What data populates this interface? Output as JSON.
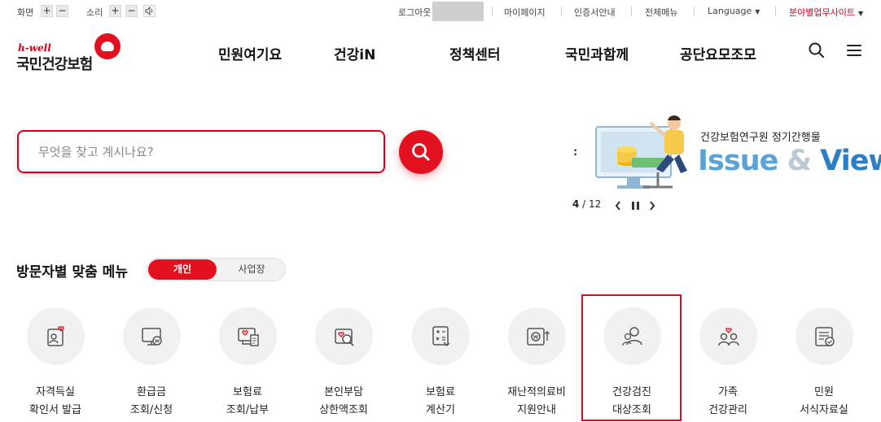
{
  "util": {
    "screen_label": "화면",
    "sound_label": "소리",
    "plus": "+",
    "minus": "−",
    "logout": "로그아웃",
    "mypage": "마이페이지",
    "cert": "인증서안내",
    "allmenu": "전체메뉴",
    "language": "Language",
    "field_site": "분야별업무사이트"
  },
  "logo": {
    "sub": "h-well",
    "name": "국민건강보험"
  },
  "gnb": [
    "민원여기요",
    "건강iN",
    "정책센터",
    "국민과함께",
    "공단요모조모"
  ],
  "search": {
    "placeholder": "무엇을 찾고 계시나요?"
  },
  "banner": {
    "colon": ":",
    "subtitle": "건강보험연구원 정기간행물",
    "title_part1": "Issue",
    "title_amp": " & ",
    "title_part2": "View",
    "page_current": "4",
    "page_sep": " / ",
    "page_total": "12"
  },
  "visitor_menu": {
    "title": "방문자별 맞춤 메뉴",
    "toggle_personal": "개인",
    "toggle_business": "사업장",
    "items": [
      {
        "line1": "자격득실",
        "line2": "확인서 발급",
        "icon": "id-card-heart-icon"
      },
      {
        "line1": "환급금",
        "line2": "조회/신청",
        "icon": "monitor-won-icon"
      },
      {
        "line1": "보험료",
        "line2": "조회/납부",
        "icon": "monitor-bill-icon"
      },
      {
        "line1": "본인부담",
        "line2": "상한액조회",
        "icon": "heart-search-icon"
      },
      {
        "line1": "보험료",
        "line2": "계산기",
        "icon": "calculator-icon"
      },
      {
        "line1": "재난적의료비",
        "line2": "지원안내",
        "icon": "coin-up-icon"
      },
      {
        "line1": "건강검진",
        "line2": "대상조회",
        "icon": "people-check-icon"
      },
      {
        "line1": "가족",
        "line2": "건강관리",
        "icon": "family-heart-icon"
      },
      {
        "line1": "민원",
        "line2": "서식자료실",
        "icon": "document-check-icon"
      }
    ]
  },
  "colors": {
    "brand_red": "#e3101f",
    "issue_blue": "#5aa3d6",
    "view_blue": "#2b7fc4"
  }
}
